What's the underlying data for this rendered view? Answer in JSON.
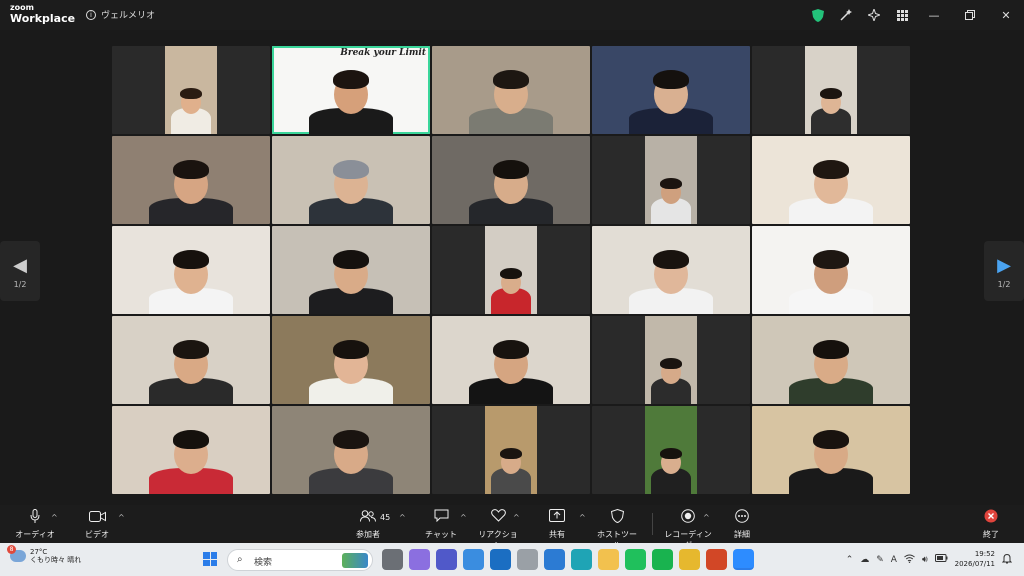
{
  "titlebar": {
    "brand_top": "zoom",
    "brand_bottom": "Workplace",
    "meeting_name": "ヴェルメリオ",
    "icons": [
      "shield-icon",
      "magic-wand-icon",
      "sparkle-icon",
      "apps-grid-icon",
      "minimize-icon",
      "restore-icon",
      "close-icon"
    ]
  },
  "nav": {
    "left_page": "1/2",
    "right_page": "1/2"
  },
  "gallery": {
    "tiles": [
      {
        "bg": "#2a2a2a",
        "pill": "#c9b79f",
        "skin": "#e0b08c",
        "hair": "#2b1c12",
        "shirt": "#f0ece4",
        "narrow": true
      },
      {
        "bg": "#f7f7f5",
        "skin": "#d6a07a",
        "hair": "#1c1410",
        "shirt": "#1a1a1a",
        "overlay": "Break your Limit",
        "active": true
      },
      {
        "bg": "#a89b8a",
        "skin": "#d8ae8c",
        "hair": "#1d1712",
        "shirt": "#7b7b72"
      },
      {
        "bg": "#394766",
        "skin": "#d9b091",
        "hair": "#15110e",
        "shirt": "#1b2238"
      },
      {
        "bg": "#2a2a2a",
        "pill": "#d8d2c8",
        "skin": "#deb595",
        "hair": "#1c1510",
        "shirt": "#2e2e2e",
        "narrow": true
      },
      {
        "bg": "#8f8072",
        "skin": "#d6a583",
        "hair": "#1a130f",
        "shirt": "#26262a"
      },
      {
        "bg": "#c9c1b4",
        "skin": "#dcb393",
        "hair": "#8a8f98",
        "shirt": "#2d333a"
      },
      {
        "bg": "#6f6a64",
        "skin": "#d7ac8a",
        "hair": "#15110d",
        "shirt": "#25272b"
      },
      {
        "bg": "#2a2a2a",
        "pill": "#b8b1a6",
        "skin": "#cfa07e",
        "hair": "#1b1410",
        "shirt": "#e5e5e5",
        "narrow": true
      },
      {
        "bg": "#ece4d8",
        "skin": "#e1b899",
        "hair": "#1f1711",
        "shirt": "#f3f3f3"
      },
      {
        "bg": "#e8e3dc",
        "skin": "#dfb290",
        "hair": "#16110d",
        "shirt": "#f4f4f4"
      },
      {
        "bg": "#c6c0b6",
        "skin": "#d9ab88",
        "hair": "#15110e",
        "shirt": "#1d1d1f"
      },
      {
        "bg": "#2a2a2a",
        "pill": "#d3cdc4",
        "skin": "#d9ad8b",
        "hair": "#17120e",
        "shirt": "#c8262c",
        "narrow": true
      },
      {
        "bg": "#e2ddd5",
        "skin": "#e0b79a",
        "hair": "#19130f",
        "shirt": "#f2f2f2"
      },
      {
        "bg": "#f4f3f1",
        "skin": "#cf9e7d",
        "hair": "#1e1712",
        "shirt": "#f6f6f6"
      },
      {
        "bg": "#d8d1c6",
        "skin": "#d9a985",
        "hair": "#1b1510",
        "shirt": "#2a2a2a"
      },
      {
        "bg": "#8c7a5c",
        "skin": "#e2b596",
        "hair": "#17120e",
        "shirt": "#f0f0ea"
      },
      {
        "bg": "#dcd6cc",
        "skin": "#d5a581",
        "hair": "#18130f",
        "shirt": "#141414"
      },
      {
        "bg": "#2a2a2a",
        "pill": "#c1b8aa",
        "skin": "#d6aa89",
        "hair": "#1a1410",
        "shirt": "#2c2c2c",
        "narrow": true
      },
      {
        "bg": "#cfc7b8",
        "skin": "#d9ab87",
        "hair": "#16110d",
        "shirt": "#2f3d2c"
      },
      {
        "bg": "#d9cfc2",
        "skin": "#dcae8d",
        "hair": "#15110d",
        "shirt": "#c92a36"
      },
      {
        "bg": "#8e8577",
        "skin": "#d8aa88",
        "hair": "#1a1410",
        "shirt": "#3b3b3e"
      },
      {
        "bg": "#2a2a2a",
        "pill": "#b89a6c",
        "skin": "#d7ab89",
        "hair": "#1a1410",
        "shirt": "#4a4a4a",
        "narrow": true
      },
      {
        "bg": "#2a2a2a",
        "pill": "#4f7a3a",
        "skin": "#d9ae8e",
        "hair": "#17120e",
        "shirt": "#202020",
        "narrow": true
      },
      {
        "bg": "#d7c4a2",
        "skin": "#d8aa86",
        "hair": "#19130f",
        "shirt": "#1a1a1a"
      }
    ]
  },
  "toolbar": {
    "audio": "オーディオ",
    "video": "ビデオ",
    "participants": "参加者",
    "participants_count": "45",
    "chat": "チャット",
    "reactions": "リアクション",
    "share": "共有",
    "host_tools": "ホストツール",
    "record": "レコーディング",
    "more": "詳細",
    "end": "終了"
  },
  "taskbar": {
    "weather_badge": "8",
    "temperature": "27°C",
    "weather_text": "くもり時々 晴れ",
    "search_placeholder": "検索",
    "time": "19:52",
    "date": "2026/07/11",
    "ime": "A",
    "apps": [
      {
        "name": "file-manager-app-icon",
        "color": "#6b6f75"
      },
      {
        "name": "copilot-app-icon",
        "color": "#8b6fe0"
      },
      {
        "name": "teams-app-icon",
        "color": "#5059c9"
      },
      {
        "name": "store-app-icon",
        "color": "#3a8de0"
      },
      {
        "name": "outlook-app-icon",
        "color": "#1b6ec2"
      },
      {
        "name": "sticky-app-icon",
        "color": "#9aa0a6"
      },
      {
        "name": "network-app-icon",
        "color": "#2c7bd3"
      },
      {
        "name": "edge-app-icon",
        "color": "#1fa4b5"
      },
      {
        "name": "folder-app-icon",
        "color": "#f2c14e"
      },
      {
        "name": "line-app-icon",
        "color": "#20c05c"
      },
      {
        "name": "line-alt-app-icon",
        "color": "#19b34f"
      },
      {
        "name": "chrome-app-icon",
        "color": "#e6b82e"
      },
      {
        "name": "powerpoint-app-icon",
        "color": "#d24726"
      },
      {
        "name": "zoom-app-icon",
        "color": "#2d8cff"
      }
    ]
  }
}
